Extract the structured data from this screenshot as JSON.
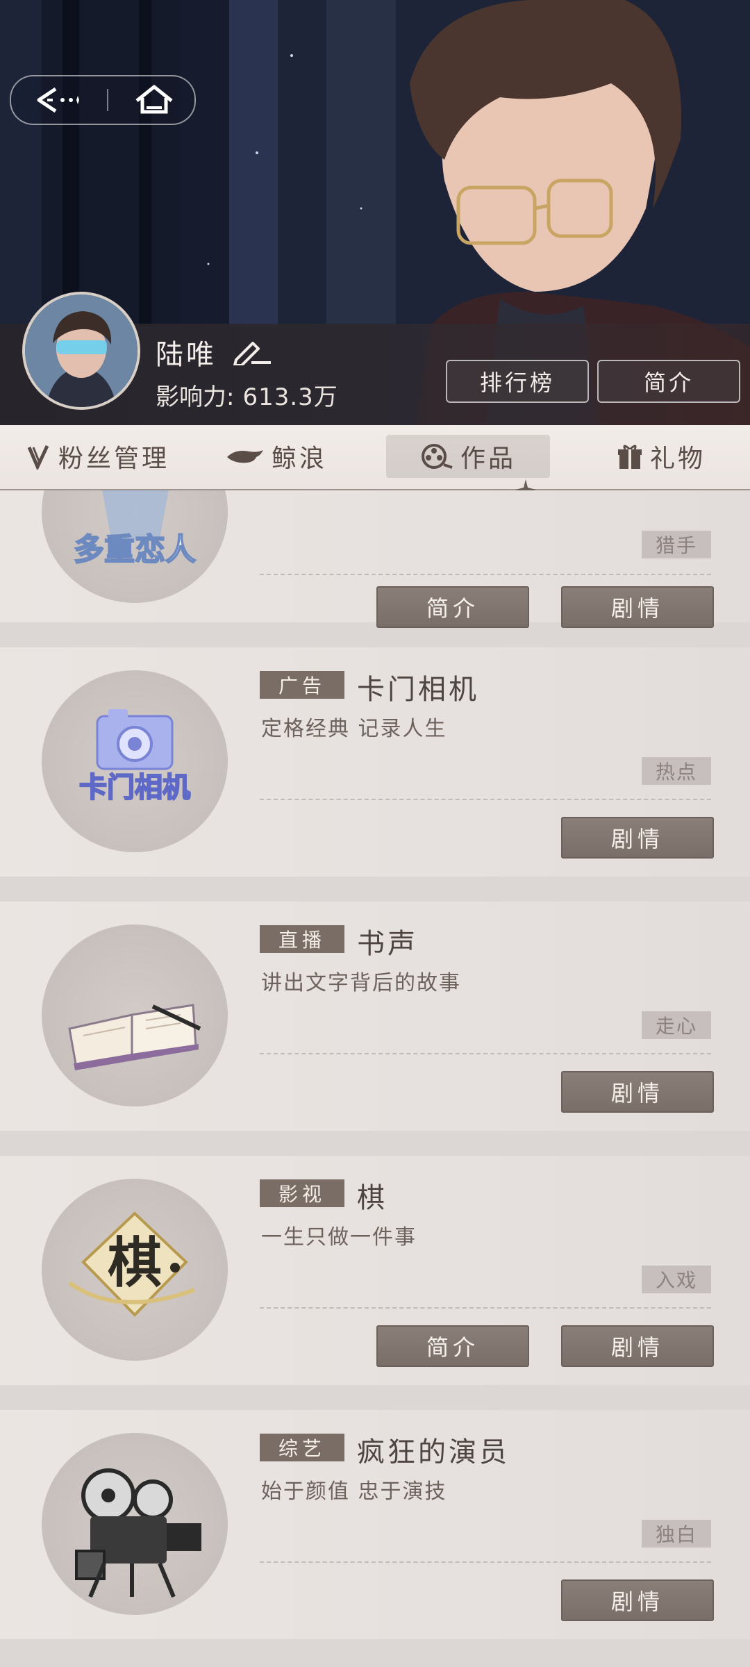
{
  "profile": {
    "name": "陆唯",
    "influence_label": "影响力:",
    "influence_value": "613.3万",
    "ranking_label": "排行榜",
    "intro_label": "简介"
  },
  "tabs": [
    {
      "label": "粉丝管理"
    },
    {
      "label": "鲸浪"
    },
    {
      "label": "作品"
    },
    {
      "label": "礼物"
    }
  ],
  "works": [
    {
      "thumb_text": "多重恋人",
      "badge": "",
      "title": "",
      "desc": "",
      "tag": "猎手",
      "intro_label": "简介",
      "plot_label": "剧情"
    },
    {
      "thumb_text": "卡门相机",
      "badge": "广告",
      "title": "卡门相机",
      "desc": "定格经典 记录人生",
      "tag": "热点",
      "plot_label": "剧情"
    },
    {
      "thumb_text": "",
      "badge": "直播",
      "title": "书声",
      "desc": "讲出文字背后的故事",
      "tag": "走心",
      "plot_label": "剧情"
    },
    {
      "thumb_text": "棋",
      "badge": "影视",
      "title": "棋",
      "desc": "一生只做一件事",
      "tag": "入戏",
      "intro_label": "简介",
      "plot_label": "剧情"
    },
    {
      "thumb_text": "",
      "badge": "综艺",
      "title": "疯狂的演员",
      "desc": "始于颜值 忠于演技",
      "tag": "独白",
      "plot_label": "剧情"
    }
  ]
}
